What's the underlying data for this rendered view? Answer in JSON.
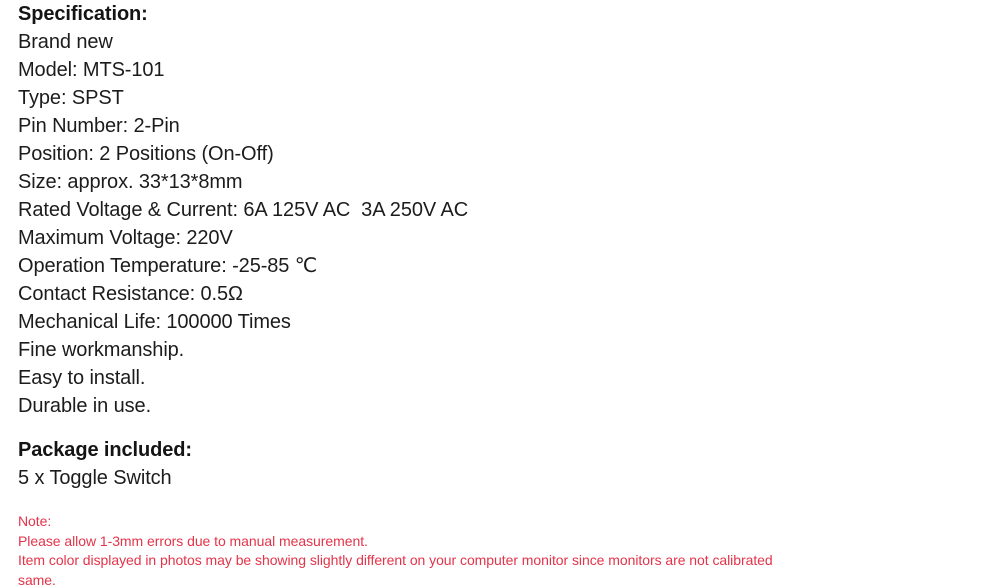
{
  "document": {
    "background_color": "#ffffff",
    "text_color": "#1c1c1c",
    "note_color": "#e3344a"
  },
  "specification": {
    "heading": "Specification:",
    "lines": [
      "Brand new",
      "Model: MTS-101",
      "Type: SPST",
      "Pin Number: 2-Pin",
      "Position: 2 Positions (On-Off)",
      "Size: approx. 33*13*8mm",
      "Rated Voltage & Current: 6A 125V AC  3A 250V AC",
      "Maximum Voltage: 220V",
      "Operation Temperature: -25-85 ℃",
      "Contact Resistance: 0.5Ω",
      "Mechanical Life: 100000 Times",
      "Fine workmanship.",
      "Easy to install.",
      "Durable in use."
    ]
  },
  "package": {
    "heading": "Package included:",
    "lines": [
      "5 x Toggle Switch"
    ]
  },
  "note": {
    "heading": "Note:",
    "lines": [
      "Please allow 1-3mm errors due to manual measurement.",
      "Item color displayed in photos may be showing slightly different on your computer monitor since monitors are not calibrated",
      "same."
    ]
  }
}
